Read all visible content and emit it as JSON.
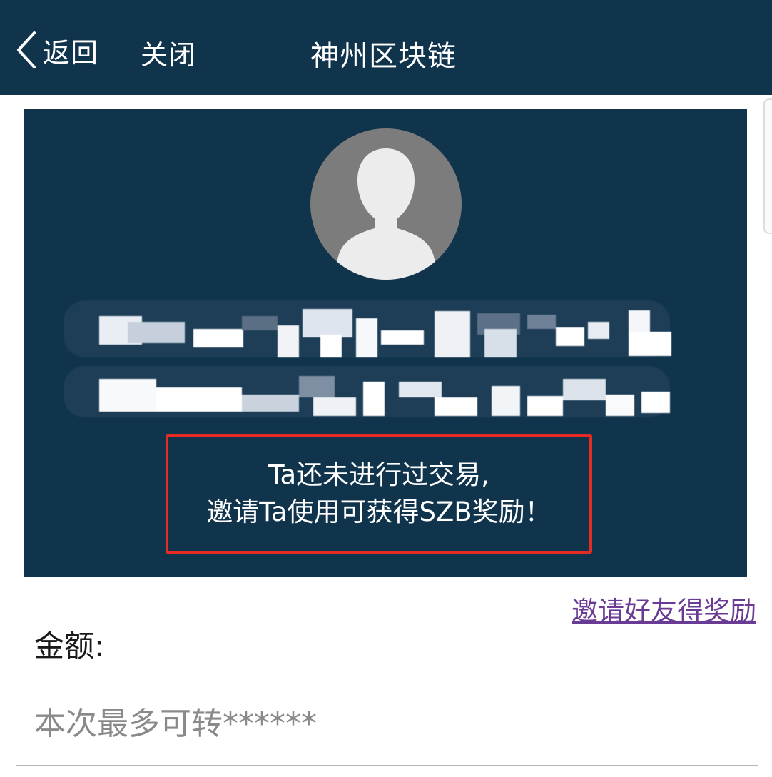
{
  "header": {
    "back_label": "返回",
    "close_label": "关闭",
    "title": "神州区块链"
  },
  "card": {
    "notice_line1": "Ta还未进行过交易,",
    "notice_line2": "邀请Ta使用可获得SZB奖励！"
  },
  "invite_link": "邀请好友得奖励",
  "amount": {
    "label": "金额:",
    "placeholder": "本次最多可转******"
  },
  "colors": {
    "header_bg": "#11344d",
    "card_bg": "#11344d",
    "highlight_border": "#e52b24",
    "link": "#6a3b94"
  },
  "icons": {
    "back": "chevron-left-icon",
    "avatar": "default-user-silhouette-icon"
  }
}
